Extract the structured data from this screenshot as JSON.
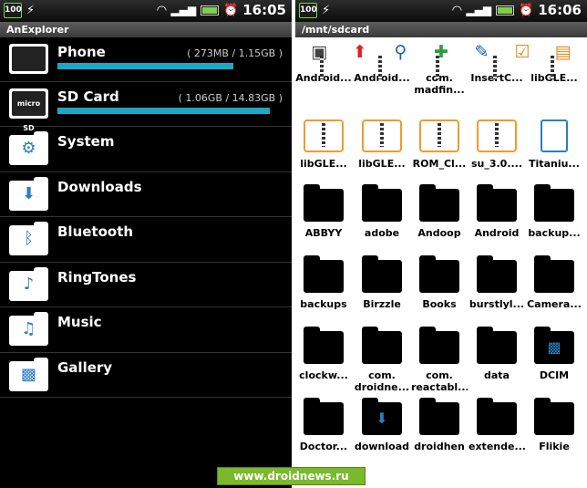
{
  "left": {
    "status": {
      "badge": "100",
      "time": "16:05"
    },
    "title": "AnExplorer",
    "drives": [
      {
        "name": "Phone",
        "size": "( 273MB / 1.15GB )",
        "fill": 0.82,
        "icon": "phone-storage-icon",
        "icon_text": ""
      },
      {
        "name": "SD Card",
        "size": "( 1.06GB / 14.83GB )",
        "fill": 0.99,
        "icon": "sd-card-icon",
        "icon_text": "micro SD"
      }
    ],
    "categories": [
      {
        "name": "System",
        "icon": "gear-icon",
        "glyph": "⚙"
      },
      {
        "name": "Downloads",
        "icon": "download-icon",
        "glyph": "⬇"
      },
      {
        "name": "Bluetooth",
        "icon": "bluetooth-icon",
        "glyph": "ᛒ"
      },
      {
        "name": "RingTones",
        "icon": "ringtone-icon",
        "glyph": "♪"
      },
      {
        "name": "Music",
        "icon": "music-icon",
        "glyph": "♫"
      },
      {
        "name": "Gallery",
        "icon": "gallery-icon",
        "glyph": "▩"
      }
    ]
  },
  "right": {
    "status": {
      "badge": "100",
      "time": "16:06"
    },
    "path": "/mnt/sdcard",
    "toolbar": [
      {
        "name": "sd-card-tool-icon",
        "glyph": "▣",
        "color": "#444444"
      },
      {
        "name": "up-arrow-icon",
        "glyph": "⬆",
        "color": "#e02020"
      },
      {
        "name": "search-icon",
        "glyph": "⚲",
        "color": "#1a5fa8"
      },
      {
        "name": "new-file-icon",
        "glyph": "✚",
        "color": "#2aa040"
      },
      {
        "name": "edit-icon",
        "glyph": "✎",
        "color": "#1a5fa8"
      },
      {
        "name": "checklist-icon",
        "glyph": "☑",
        "color": "#e08a1a"
      },
      {
        "name": "archive-icon",
        "glyph": "▤",
        "color": "#e08a1a"
      }
    ],
    "files": [
      {
        "label": "Android...",
        "type": "partial"
      },
      {
        "label": "Android...",
        "type": "partial"
      },
      {
        "label": "com.\nmadfin...",
        "type": "partial"
      },
      {
        "label": "InsertC...",
        "type": "partial"
      },
      {
        "label": "libGLE...",
        "type": "partial"
      },
      {
        "label": "libGLE...",
        "type": "zip"
      },
      {
        "label": "libGLE...",
        "type": "zip"
      },
      {
        "label": "ROM_Cl...",
        "type": "zip"
      },
      {
        "label": "su_3.0....",
        "type": "zip"
      },
      {
        "label": "Titaniu...",
        "type": "doc"
      },
      {
        "label": "ABBYY",
        "type": "folder"
      },
      {
        "label": "adobe",
        "type": "folder"
      },
      {
        "label": "Andoop",
        "type": "folder"
      },
      {
        "label": "Android",
        "type": "folder"
      },
      {
        "label": "backup...",
        "type": "folder"
      },
      {
        "label": "backups",
        "type": "folder"
      },
      {
        "label": "Birzzle",
        "type": "folder"
      },
      {
        "label": "Books",
        "type": "folder"
      },
      {
        "label": "burstlyl...",
        "type": "folder"
      },
      {
        "label": "Camera...",
        "type": "folder"
      },
      {
        "label": "clockw...",
        "type": "folder"
      },
      {
        "label": "com.\ndroidne...",
        "type": "folder"
      },
      {
        "label": "com.\nreactabl...",
        "type": "folder"
      },
      {
        "label": "data",
        "type": "folder"
      },
      {
        "label": "DCIM",
        "type": "gallery-folder"
      },
      {
        "label": "Doctor...",
        "type": "folder"
      },
      {
        "label": "download",
        "type": "download-folder"
      },
      {
        "label": "droidhen",
        "type": "folder"
      },
      {
        "label": "extende...",
        "type": "folder"
      },
      {
        "label": "Flikie",
        "type": "folder"
      }
    ]
  },
  "watermark": "www.droidnews.ru"
}
